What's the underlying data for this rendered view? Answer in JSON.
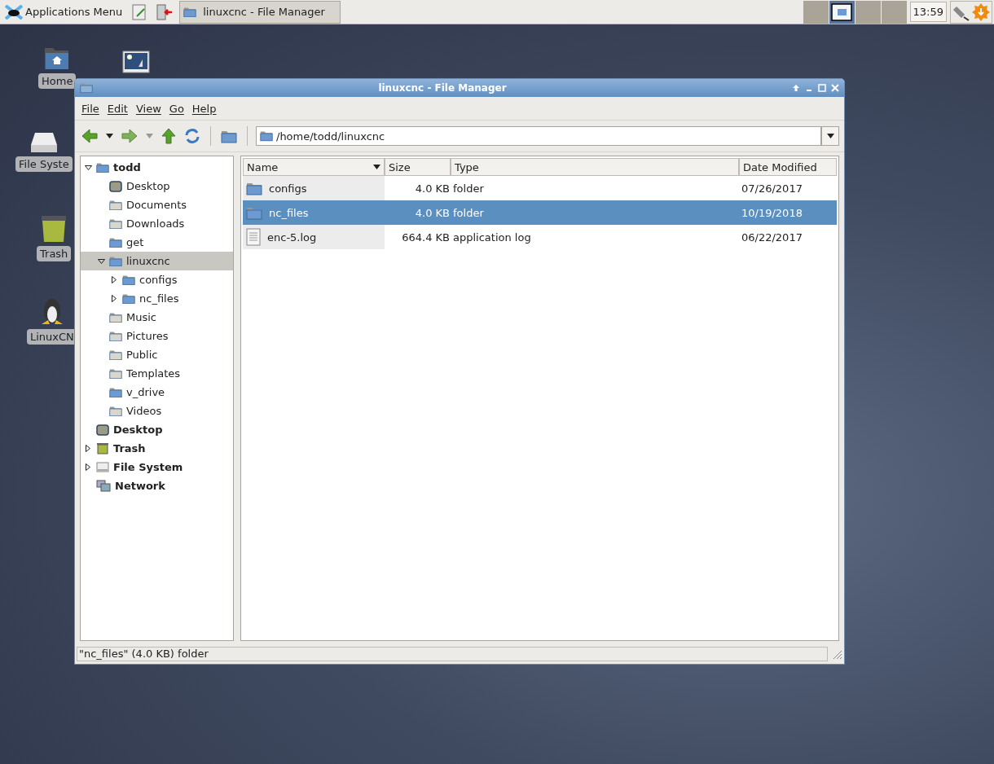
{
  "taskbar": {
    "app_menu": "Applications Menu",
    "tasks": [
      {
        "label": "linuxcnc - File Manager",
        "selected": true
      }
    ],
    "workspaces": [
      {
        "selected": false
      },
      {
        "selected": true
      },
      {
        "selected": false
      },
      {
        "selected": false
      }
    ],
    "clock": "13:59"
  },
  "desktop_icons": [
    {
      "kind": "home",
      "label": "Home"
    },
    {
      "kind": "image"
    },
    {
      "kind": "drive",
      "label": "File Syste"
    },
    {
      "kind": "trash",
      "label": "Trash"
    },
    {
      "kind": "penguin",
      "label": "LinuxCN"
    }
  ],
  "window": {
    "title": "linuxcnc - File Manager"
  },
  "menu": [
    "File",
    "Edit",
    "View",
    "Go",
    "Help"
  ],
  "location": "/home/todd/linuxcnc",
  "sidebar": {
    "items": [
      {
        "label": "todd",
        "kind": "home",
        "selected": false,
        "expanded": true,
        "children": [
          {
            "label": "Desktop",
            "kind": "desktop",
            "selected": false
          },
          {
            "label": "Documents",
            "kind": "special",
            "selected": false
          },
          {
            "label": "Downloads",
            "kind": "special",
            "selected": false
          },
          {
            "label": "get",
            "kind": "folder",
            "selected": false
          },
          {
            "label": "linuxcnc",
            "kind": "folder",
            "selected": true,
            "expanded": true,
            "children": [
              {
                "label": "configs",
                "kind": "folder",
                "selected": false,
                "expanded": false
              },
              {
                "label": "nc_files",
                "kind": "folder",
                "selected": false,
                "expanded": false
              }
            ]
          },
          {
            "label": "Music",
            "kind": "special",
            "selected": false
          },
          {
            "label": "Pictures",
            "kind": "special",
            "selected": false
          },
          {
            "label": "Public",
            "kind": "special",
            "selected": false
          },
          {
            "label": "Templates",
            "kind": "special",
            "selected": false
          },
          {
            "label": "v_drive",
            "kind": "folder",
            "selected": false
          },
          {
            "label": "Videos",
            "kind": "special",
            "selected": false
          }
        ]
      },
      {
        "label": "Desktop",
        "kind": "desktop",
        "selected": false
      },
      {
        "label": "Trash",
        "kind": "trash",
        "selected": false,
        "expanded": false
      },
      {
        "label": "File System",
        "kind": "drive",
        "selected": false,
        "expanded": false
      },
      {
        "label": "Network",
        "kind": "network",
        "selected": false
      }
    ]
  },
  "table": {
    "columns": [
      {
        "label": "Name",
        "sorted": true
      },
      {
        "label": "Size",
        "sorted": false
      },
      {
        "label": "Type",
        "sorted": false
      },
      {
        "label": "Date Modified",
        "sorted": false
      }
    ],
    "rows": [
      {
        "kind": "folder",
        "name": "configs",
        "size": "4.0 KB",
        "type": "folder",
        "date": "07/26/2017",
        "selected": false
      },
      {
        "kind": "folder",
        "name": "nc_files",
        "size": "4.0 KB",
        "type": "folder",
        "date": "10/19/2018",
        "selected": true
      },
      {
        "kind": "file",
        "name": "enc-5.log",
        "size": "664.4 KB",
        "type": "application log",
        "date": "06/22/2017",
        "selected": false
      }
    ]
  },
  "status_bar": "\"nc_files\" (4.0 KB) folder"
}
